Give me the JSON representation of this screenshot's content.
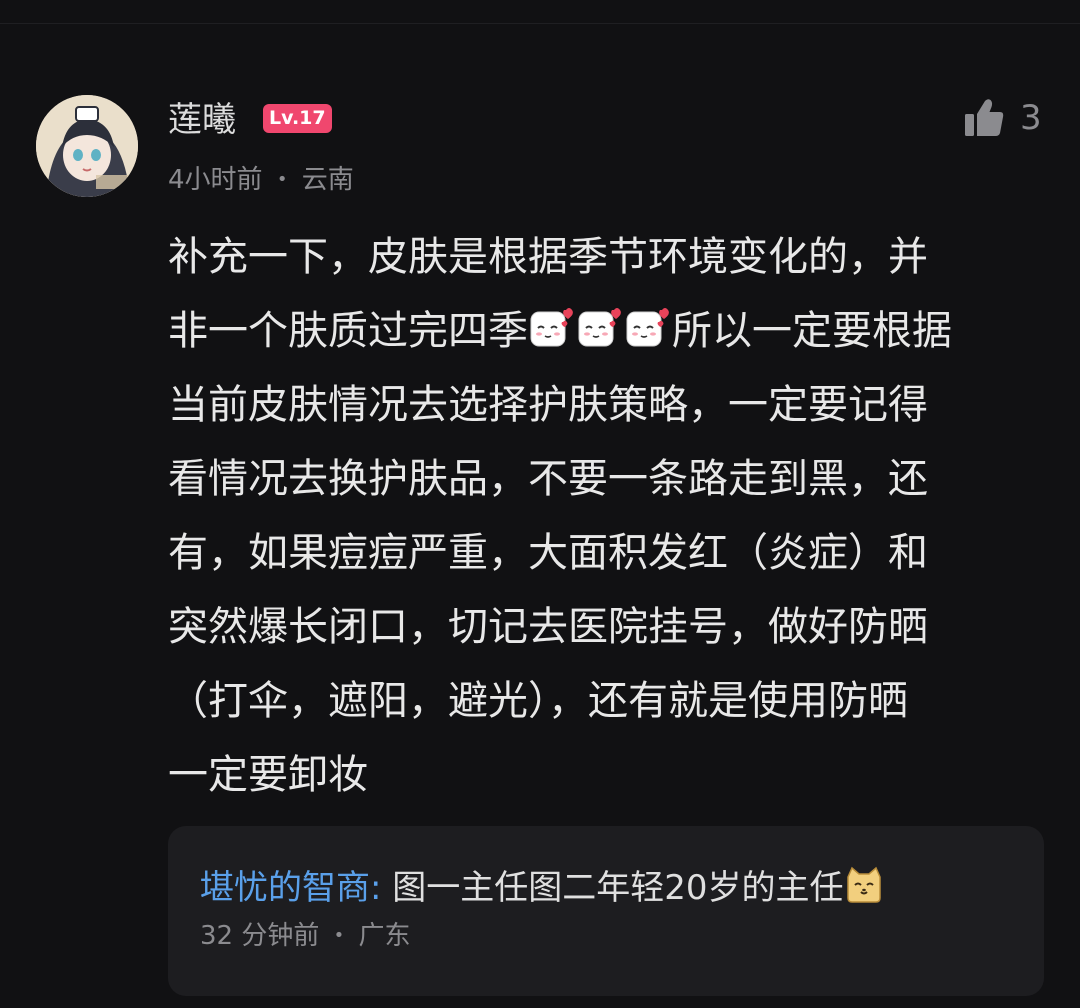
{
  "comment": {
    "author": "莲曦",
    "level_badge": "Lv.17",
    "time": "4小时前",
    "location": "云南",
    "meta_separator": "•",
    "like_count": "3",
    "body_parts": [
      "补充一下，皮肤是根据季节环境变化的，并\n非一个肤质过完四季",
      "所以一定要根据\n当前皮肤情况去选择护肤策略，一定要记得\n看情况去换护肤品，不要一条路走到黑，还\n有，如果痘痘严重，大面积发红（炎症）和\n突然爆长闭口，切记去医院挂号，做好防晒\n（打伞，遮阳，避光），还有就是使用防晒\n一定要卸妆"
    ],
    "inline_emoji_count": 3
  },
  "reply": {
    "author": "堪忧的智商",
    "separator": ":",
    "text": " 图一主任图二年轻20岁的主任",
    "time": "32 分钟前",
    "location": "广东",
    "meta_separator": "•"
  },
  "colors": {
    "background": "#111113",
    "badge": "#f0476e",
    "reply_author": "#5aa0ea",
    "card": "#1d1d20"
  },
  "icons": [
    "avatar",
    "thumbs-up-icon",
    "blush-emoji-icon",
    "cat-emoji-icon"
  ]
}
